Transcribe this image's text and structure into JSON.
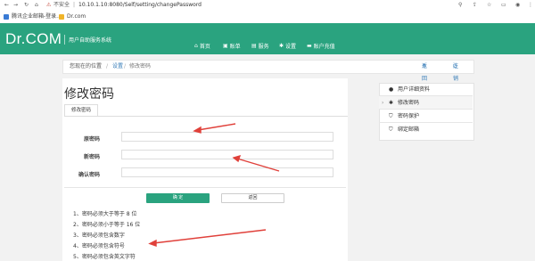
{
  "browser": {
    "security_label": "不安全",
    "url": "10.10.1.10:8080/Self/setting/changePassword"
  },
  "bookmarks": [
    {
      "label": "腾讯企业邮箱-登录..."
    },
    {
      "label": "Dr.com"
    }
  ],
  "header": {
    "logo": "Dr.COM",
    "subtitle": "用户自助服务系统",
    "nav": [
      {
        "icon": "⌂",
        "label": "首页"
      },
      {
        "icon": "▣",
        "label": "账单"
      },
      {
        "icon": "▤",
        "label": "服务"
      },
      {
        "icon": "✱",
        "label": "设置"
      },
      {
        "icon": "▬",
        "label": "账户充值"
      }
    ]
  },
  "breadcrumb": {
    "prefix": "您现在的位置",
    "level1": "设置",
    "level2": "修改密码",
    "back_home": "返回首页",
    "logout": "注销"
  },
  "page": {
    "title": "修改密码",
    "tab": "修改密码"
  },
  "form": {
    "old_password_label": "原密码",
    "new_password_label": "新密码",
    "confirm_password_label": "确认密码",
    "confirm_button": "确 定",
    "back_button": "返回"
  },
  "rules": [
    "1、密码必须大于等于 8 位",
    "2、密码必须小于等于 16 位",
    "3、密码必须包含数字",
    "4、密码必须包含符号",
    "5、密码必须包含英文字符"
  ],
  "sidebar": {
    "items": [
      {
        "icon": "user-icon",
        "label": "用户详细资料"
      },
      {
        "icon": "gear-icon",
        "label": "修改密码",
        "active": true
      },
      {
        "icon": "shield-icon",
        "label": "密码保护"
      },
      {
        "icon": "shield-icon",
        "label": "绑定邮箱"
      }
    ]
  },
  "colors": {
    "brand": "#2aa37f",
    "annotation_arrow": "#e0403a"
  }
}
